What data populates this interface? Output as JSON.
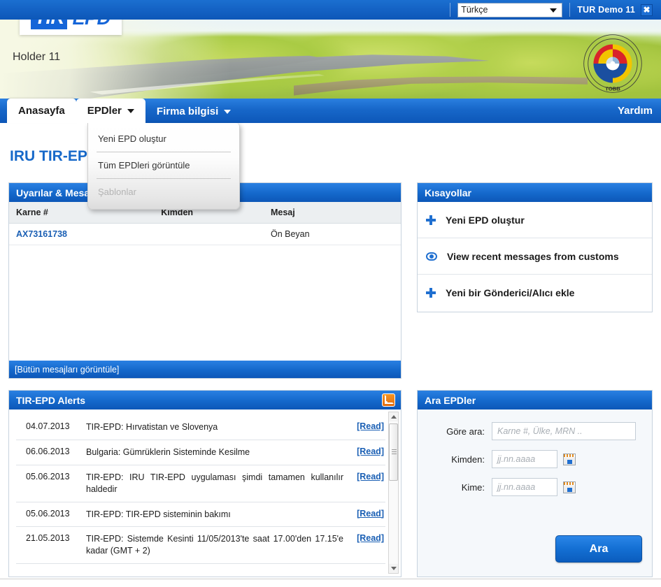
{
  "topbar": {
    "language_selected": "Türkçe",
    "language_options": [
      "Türkçe"
    ],
    "user_label": "TUR Demo 11",
    "logout_icon": "close-icon"
  },
  "branding": {
    "logo_tir": "TIR",
    "logo_epd": "EPD",
    "holder_name": "Holder 11",
    "tobb_logo_text": "THE UNION OF CHAMBERS AND COMMODITY EXCHANGES OF TURKEY",
    "tobb_logo_abbr": "TOBB"
  },
  "nav": {
    "tabs": [
      {
        "label": "Anasayfa",
        "state": "active",
        "has_caret": false
      },
      {
        "label": "EPDler",
        "state": "open",
        "has_caret": true
      },
      {
        "label": "Firma bilgisi",
        "state": "normal",
        "has_caret": true
      }
    ],
    "help_label": "Yardım"
  },
  "dropdown": {
    "items": [
      {
        "label": "Yeni EPD oluştur",
        "disabled": false
      },
      {
        "label": "Tüm EPDleri görüntüle",
        "disabled": false
      },
      {
        "label": "Şablonlar",
        "disabled": true
      }
    ]
  },
  "page_title": "IRU TIR-EPD",
  "messages_panel": {
    "title": "Uyarılar & Mesajlar",
    "columns": [
      "Karne #",
      "Kimden",
      "Mesaj"
    ],
    "rows": [
      {
        "karne": "AX73161738",
        "kimden": "",
        "mesaj": "Ön Beyan"
      }
    ],
    "footer_link": "[Bütün mesajları görüntüle]"
  },
  "shortcuts_panel": {
    "title": "Kısayollar",
    "items": [
      {
        "icon": "plus-icon",
        "label": "Yeni EPD oluştur"
      },
      {
        "icon": "eye-icon",
        "label": "View recent messages from customs"
      },
      {
        "icon": "plus-icon",
        "label": "Yeni bir Gönderici/Alıcı ekle"
      }
    ]
  },
  "alerts_panel": {
    "title": "TIR-EPD Alerts",
    "rss_icon": "rss-icon",
    "read_label": "[Read]",
    "rows": [
      {
        "date": "04.07.2013",
        "text": "TIR-EPD: Hırvatistan ve Slovenya"
      },
      {
        "date": "06.06.2013",
        "text": "Bulgaria: Gümrüklerin Sisteminde Kesilme"
      },
      {
        "date": "05.06.2013",
        "text": "TIR-EPD: IRU TIR-EPD uygulaması şimdi tamamen kullanılır haldedir"
      },
      {
        "date": "05.06.2013",
        "text": "TIR-EPD: TIR-EPD sisteminin bakımı"
      },
      {
        "date": "21.05.2013",
        "text": "TIR-EPD: Sistemde Kesinti 11/05/2013'te saat 17.00'den 17.15'e kadar (GMT + 2)"
      }
    ]
  },
  "search_panel": {
    "title": "Ara EPDler",
    "fields": [
      {
        "label": "Göre ara:",
        "value": "",
        "placeholder": "Karne #, Ülke, MRN ..",
        "has_calendar": false
      },
      {
        "label": "Kimden:",
        "value": "",
        "placeholder": "jj.nn.aaaa",
        "has_calendar": true
      },
      {
        "label": "Kime:",
        "value": "",
        "placeholder": "jj.nn.aaaa",
        "has_calendar": true
      }
    ],
    "submit_label": "Ara"
  },
  "colors": {
    "brand_blue": "#1565d8",
    "header_blue": "#0d57b8",
    "link_blue": "#1a5fb4",
    "rss_orange": "#e06c12"
  }
}
